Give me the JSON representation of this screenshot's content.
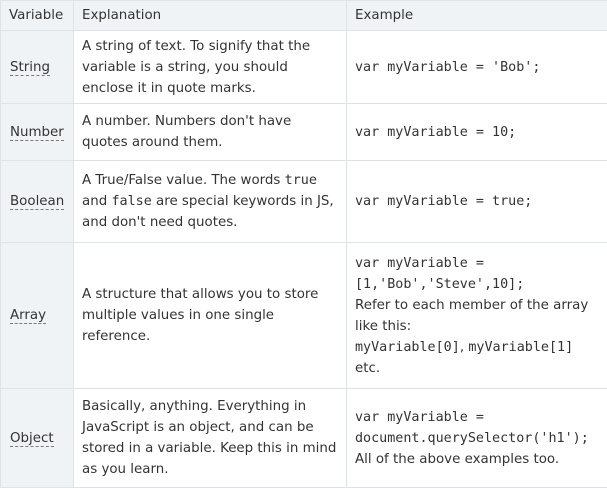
{
  "headers": {
    "variable": "Variable",
    "explanation": "Explanation",
    "example": "Example"
  },
  "rows": [
    {
      "variable": "String",
      "explanation": "A string of text. To signify that the variable is a string, you should enclose it in quote marks.",
      "example_code": "var myVariable = 'Bob';"
    },
    {
      "variable": "Number",
      "explanation": "A number. Numbers don't have quotes around them.",
      "example_code": "var myVariable = 10;"
    },
    {
      "variable": "Boolean",
      "explanation_parts": [
        "A True/False value. The words ",
        "true",
        " and ",
        "false",
        " are special keywords in JS, and don't need quotes."
      ],
      "example_code": "var myVariable = true;"
    },
    {
      "variable": "Array",
      "explanation": "A structure that allows you to store multiple values in one single reference.",
      "example_code_1": "var myVariable =",
      "example_code_2": "[1,'Bob','Steve',10];",
      "example_text_1": "Refer to each member of the array like this:",
      "example_code_3": "myVariable[0]",
      "example_sep": ", ",
      "example_code_4": "myVariable[1]",
      "example_text_2": "etc."
    },
    {
      "variable": "Object",
      "explanation": "Basically, anything. Everything in JavaScript is an object, and can be stored in a variable. Keep this in mind as you learn.",
      "example_code_1": "var myVariable =",
      "example_code_2": "document.querySelector('h1');",
      "example_text_1": "All of the above examples too."
    }
  ]
}
